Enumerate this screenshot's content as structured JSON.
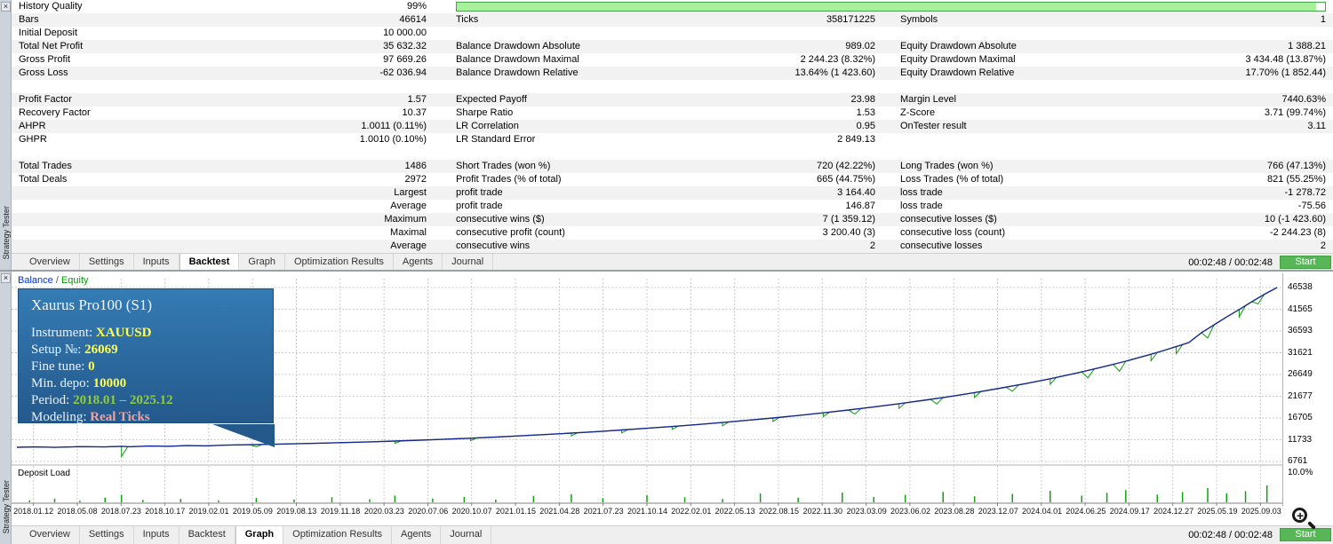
{
  "app": {
    "panel_title": "Strategy Tester",
    "close_glyph": "×",
    "timer": "00:02:48 / 00:02:48",
    "start_label": "Start"
  },
  "tabs": {
    "items": [
      "Overview",
      "Settings",
      "Inputs",
      "Backtest",
      "Graph",
      "Optimization Results",
      "Agents",
      "Journal"
    ],
    "top_selected": 3,
    "bottom_selected": 4
  },
  "stats": {
    "rows": [
      {
        "shade": false,
        "c1l": "History Quality",
        "c1v": "99%",
        "bar": 99
      },
      {
        "shade": true,
        "c1l": "Bars",
        "c1v": "46614",
        "c2l": "Ticks",
        "c2v": "358171225",
        "c3l": "Symbols",
        "c3v": "1"
      },
      {
        "shade": false,
        "c1l": "Initial Deposit",
        "c1v": "10 000.00"
      },
      {
        "shade": true,
        "c1l": "Total Net Profit",
        "c1v": "35 632.32",
        "c2l": "Balance Drawdown Absolute",
        "c2v": "989.02",
        "c3l": "Equity Drawdown Absolute",
        "c3v": "1 388.21"
      },
      {
        "shade": false,
        "c1l": "Gross Profit",
        "c1v": "97 669.26",
        "c2l": "Balance Drawdown Maximal",
        "c2v": "2 244.23 (8.32%)",
        "c3l": "Equity Drawdown Maximal",
        "c3v": "3 434.48 (13.87%)"
      },
      {
        "shade": true,
        "c1l": "Gross Loss",
        "c1v": "-62 036.94",
        "c2l": "Balance Drawdown Relative",
        "c2v": "13.64% (1 423.60)",
        "c3l": "Equity Drawdown Relative",
        "c3v": "17.70% (1 852.44)"
      },
      {
        "shade": false
      },
      {
        "shade": true,
        "c1l": "Profit Factor",
        "c1v": "1.57",
        "c2l": "Expected Payoff",
        "c2v": "23.98",
        "c3l": "Margin Level",
        "c3v": "7440.63%"
      },
      {
        "shade": false,
        "c1l": "Recovery Factor",
        "c1v": "10.37",
        "c2l": "Sharpe Ratio",
        "c2v": "1.53",
        "c3l": "Z-Score",
        "c3v": "3.71 (99.74%)"
      },
      {
        "shade": true,
        "c1l": "AHPR",
        "c1v": "1.0011 (0.11%)",
        "c2l": "LR Correlation",
        "c2v": "0.95",
        "c3l": "OnTester result",
        "c3v": "3.11"
      },
      {
        "shade": false,
        "c1l": "GHPR",
        "c1v": "1.0010 (0.10%)",
        "c2l": "LR Standard Error",
        "c2v": "2 849.13"
      },
      {
        "shade": false
      },
      {
        "shade": true,
        "c1l": "Total Trades",
        "c1v": "1486",
        "c2l": "Short Trades (won %)",
        "c2v": "720 (42.22%)",
        "c3l": "Long Trades (won %)",
        "c3v": "766 (47.13%)"
      },
      {
        "shade": false,
        "c1l": "Total Deals",
        "c1v": "2972",
        "c2l": "Profit Trades (% of total)",
        "c2v": "665 (44.75%)",
        "c3l": "Loss Trades (% of total)",
        "c3v": "821 (55.25%)"
      },
      {
        "shade": true,
        "c1v": "Largest",
        "c2l": "profit trade",
        "c2v": "3 164.40",
        "c3l": "loss trade",
        "c3v": "-1 278.72"
      },
      {
        "shade": false,
        "c1v": "Average",
        "c2l": "profit trade",
        "c2v": "146.87",
        "c3l": "loss trade",
        "c3v": "-75.56"
      },
      {
        "shade": true,
        "c1v": "Maximum",
        "c2l": "consecutive wins ($)",
        "c2v": "7 (1 359.12)",
        "c3l": "consecutive losses ($)",
        "c3v": "10 (-1 423.60)"
      },
      {
        "shade": false,
        "c1v": "Maximal",
        "c2l": "consecutive profit (count)",
        "c2v": "3 200.40 (3)",
        "c3l": "consecutive loss (count)",
        "c3v": "-2 244.23 (8)"
      },
      {
        "shade": true,
        "c1v": "Average",
        "c2l": "consecutive wins",
        "c2v": "2",
        "c3l": "consecutive losses",
        "c3v": "2"
      }
    ]
  },
  "graph": {
    "legend_balance": "Balance",
    "legend_sep": " / ",
    "legend_equity": "Equity",
    "info_box": {
      "title": "Xaurus Pro100 (S1)",
      "colors": {
        "yellow": "#ffff52",
        "green": "#8fcc41",
        "pink": "#f2a19e"
      },
      "lines": [
        {
          "label": "Instrument: ",
          "value": "XAUUSD",
          "color": "yellow"
        },
        {
          "label": "Setup №: ",
          "value": "26069",
          "color": "yellow"
        },
        {
          "label": "Fine tune: ",
          "value": "0",
          "color": "yellow"
        },
        {
          "label": "Min. depo: ",
          "value": "10000",
          "color": "yellow"
        },
        {
          "label": "Period: ",
          "value": "2018.01 – 2025.12",
          "color": "green"
        },
        {
          "label": "Modeling: ",
          "value": "Real Ticks",
          "color": "pink"
        }
      ]
    }
  },
  "chart_data": {
    "type": "line",
    "title": "Balance / Equity backtest curve",
    "y_ticks": [
      46538,
      41565,
      36593,
      31621,
      26649,
      21677,
      16705,
      11733,
      6761
    ],
    "x_ticks": [
      "2018.01.12",
      "2018.05.08",
      "2018.07.23",
      "2018.10.17",
      "2019.02.01",
      "2019.05.09",
      "2019.08.13",
      "2019.11.18",
      "2020.03.23",
      "2020.07.06",
      "2020.10.07",
      "2021.01.15",
      "2021.04.28",
      "2021.07.23",
      "2021.10.14",
      "2022.02.01",
      "2022.05.13",
      "2022.08.15",
      "2022.11.30",
      "2023.03.09",
      "2023.06.02",
      "2023.08.28",
      "2023.12.07",
      "2024.04.01",
      "2024.06.25",
      "2024.09.17",
      "2024.12.27",
      "2025.05.19",
      "2025.09.03"
    ],
    "grid": true,
    "legend_position": "top-left",
    "series": [
      {
        "name": "Balance",
        "color": "#16288f",
        "points": [
          [
            0.0,
            10000
          ],
          [
            0.015,
            10080
          ],
          [
            0.03,
            9980
          ],
          [
            0.05,
            10150
          ],
          [
            0.07,
            10080
          ],
          [
            0.083,
            10220
          ],
          [
            0.09,
            10120
          ],
          [
            0.105,
            10280
          ],
          [
            0.12,
            10220
          ],
          [
            0.135,
            10380
          ],
          [
            0.15,
            10330
          ],
          [
            0.165,
            10480
          ],
          [
            0.18,
            10560
          ],
          [
            0.2,
            10680
          ],
          [
            0.22,
            10790
          ],
          [
            0.24,
            10930
          ],
          [
            0.26,
            11080
          ],
          [
            0.28,
            11240
          ],
          [
            0.3,
            11420
          ],
          [
            0.32,
            11620
          ],
          [
            0.34,
            11840
          ],
          [
            0.36,
            12080
          ],
          [
            0.38,
            12340
          ],
          [
            0.4,
            12620
          ],
          [
            0.42,
            12920
          ],
          [
            0.44,
            13240
          ],
          [
            0.46,
            13580
          ],
          [
            0.48,
            13950
          ],
          [
            0.5,
            14340
          ],
          [
            0.52,
            14760
          ],
          [
            0.54,
            15200
          ],
          [
            0.56,
            15670
          ],
          [
            0.58,
            16170
          ],
          [
            0.6,
            16700
          ],
          [
            0.62,
            17270
          ],
          [
            0.64,
            17880
          ],
          [
            0.66,
            18530
          ],
          [
            0.68,
            19220
          ],
          [
            0.7,
            19960
          ],
          [
            0.72,
            20750
          ],
          [
            0.74,
            21600
          ],
          [
            0.76,
            22510
          ],
          [
            0.78,
            23490
          ],
          [
            0.8,
            24540
          ],
          [
            0.82,
            25680
          ],
          [
            0.84,
            26910
          ],
          [
            0.86,
            28240
          ],
          [
            0.88,
            29690
          ],
          [
            0.9,
            31270
          ],
          [
            0.91,
            32120
          ],
          [
            0.92,
            33010
          ],
          [
            0.93,
            33950
          ],
          [
            0.94,
            36200
          ],
          [
            0.95,
            38000
          ],
          [
            0.96,
            39800
          ],
          [
            0.97,
            41500
          ],
          [
            0.98,
            43300
          ],
          [
            0.99,
            45000
          ],
          [
            1.0,
            46538
          ]
        ]
      },
      {
        "name": "Equity",
        "color": "#0f9b0f",
        "dips": [
          [
            0.083,
            7900
          ],
          [
            0.19,
            10150
          ],
          [
            0.3,
            10900
          ],
          [
            0.36,
            11500
          ],
          [
            0.44,
            12600
          ],
          [
            0.48,
            13300
          ],
          [
            0.52,
            14100
          ],
          [
            0.56,
            14900
          ],
          [
            0.6,
            15900
          ],
          [
            0.64,
            17000
          ],
          [
            0.665,
            17600
          ],
          [
            0.7,
            18900
          ],
          [
            0.73,
            19900
          ],
          [
            0.76,
            21400
          ],
          [
            0.79,
            22800
          ],
          [
            0.82,
            24400
          ],
          [
            0.85,
            25900
          ],
          [
            0.875,
            27400
          ],
          [
            0.9,
            29800
          ],
          [
            0.92,
            31400
          ],
          [
            0.945,
            35000
          ],
          [
            0.97,
            39800
          ],
          [
            0.985,
            42800
          ]
        ]
      }
    ],
    "deposit_load": {
      "label": "Deposit Load",
      "max_label": "10.0%",
      "spikes": [
        [
          0.01,
          0.6
        ],
        [
          0.03,
          1.1
        ],
        [
          0.05,
          0.5
        ],
        [
          0.07,
          1.4
        ],
        [
          0.083,
          2.2
        ],
        [
          0.1,
          0.7
        ],
        [
          0.13,
          1.0
        ],
        [
          0.16,
          0.6
        ],
        [
          0.19,
          1.3
        ],
        [
          0.22,
          0.8
        ],
        [
          0.25,
          1.5
        ],
        [
          0.28,
          0.9
        ],
        [
          0.3,
          2.0
        ],
        [
          0.33,
          1.1
        ],
        [
          0.355,
          1.6
        ],
        [
          0.38,
          0.8
        ],
        [
          0.41,
          1.9
        ],
        [
          0.44,
          2.4
        ],
        [
          0.465,
          1.2
        ],
        [
          0.5,
          2.1
        ],
        [
          0.53,
          1.5
        ],
        [
          0.56,
          1.0
        ],
        [
          0.59,
          2.6
        ],
        [
          0.62,
          1.4
        ],
        [
          0.655,
          2.9
        ],
        [
          0.68,
          1.6
        ],
        [
          0.705,
          2.2
        ],
        [
          0.735,
          3.1
        ],
        [
          0.76,
          1.8
        ],
        [
          0.79,
          2.5
        ],
        [
          0.82,
          3.4
        ],
        [
          0.845,
          2.0
        ],
        [
          0.865,
          2.8
        ],
        [
          0.88,
          3.6
        ],
        [
          0.905,
          2.3
        ],
        [
          0.925,
          3.0
        ],
        [
          0.945,
          4.2
        ],
        [
          0.96,
          2.6
        ],
        [
          0.975,
          3.3
        ],
        [
          0.992,
          5.0
        ]
      ]
    }
  }
}
